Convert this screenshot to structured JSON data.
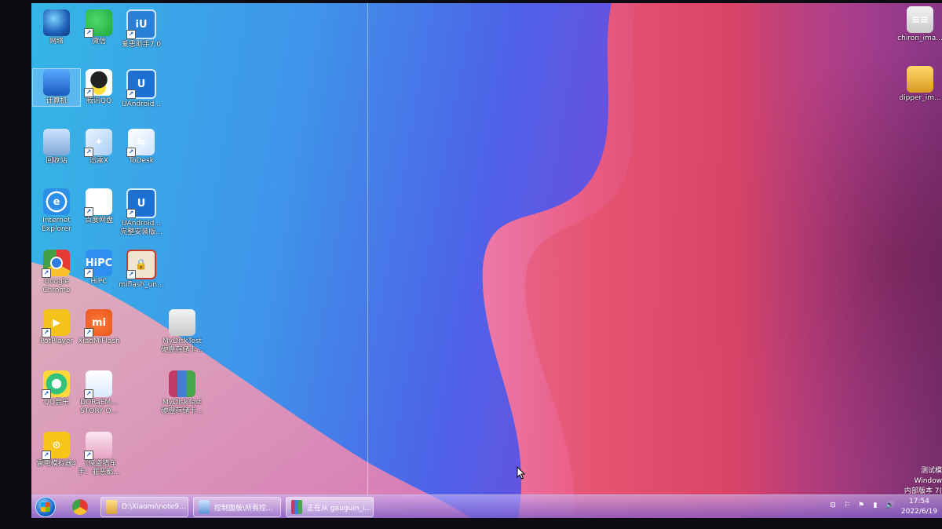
{
  "desktop": {
    "icons": [
      {
        "label": "网络",
        "glyph": "",
        "cls": "g-globe"
      },
      {
        "label": "微信",
        "glyph": "",
        "cls": "g-wechat"
      },
      {
        "label": "爱思助手7.0",
        "glyph": "iU",
        "cls": "g-iu"
      },
      {
        "label": "计算机",
        "glyph": "",
        "cls": "g-pc"
      },
      {
        "label": "腾讯QQ",
        "glyph": "",
        "cls": "g-qq"
      },
      {
        "label": "UAndroid...",
        "glyph": "U",
        "cls": "g-uand"
      },
      {
        "label": "回收站",
        "glyph": "",
        "cls": "g-bin"
      },
      {
        "label": "迅雷X",
        "glyph": "✦",
        "cls": "g-xunlei"
      },
      {
        "label": "ToDesk",
        "glyph": "⇆",
        "cls": "g-todesk"
      },
      {
        "label": "Internet\nExplorer",
        "glyph": "e",
        "cls": "g-ie"
      },
      {
        "label": "百度网盘",
        "glyph": "∞",
        "cls": "g-baidu"
      },
      {
        "label": "UAndroid...\n完整安装版...",
        "glyph": "U",
        "cls": "g-uand"
      },
      {
        "label": "Google\nChrome",
        "glyph": "",
        "cls": "g-chrome"
      },
      {
        "label": "HiPC",
        "glyph": "HiPC",
        "cls": "g-hipc"
      },
      {
        "label": "miflash_un...",
        "glyph": "🔒",
        "cls": "g-miflash"
      },
      {
        "label": "PotPlayer",
        "glyph": "▶",
        "cls": "g-pot"
      },
      {
        "label": "XiaoMiFlash",
        "glyph": "mi",
        "cls": "g-mi"
      },
      {
        "label": "MyDiskTest\n硬盘存储卡...",
        "glyph": "",
        "cls": "g-folder"
      },
      {
        "label": "QQ音乐",
        "glyph": "",
        "cls": "g-qqmusic"
      },
      {
        "label": "DORaEM...\nSTORY O...",
        "glyph": "",
        "cls": "g-dora"
      },
      {
        "label": "MyDiskTest\n硬盘存储卡...",
        "glyph": "",
        "cls": "g-rar"
      },
      {
        "label": "雷电模拟器4",
        "glyph": "⊙",
        "cls": "g-leidian"
      },
      {
        "label": "《侠盗猎车\n手：罪恶都...",
        "glyph": "",
        "cls": "g-anime"
      },
      {
        "label": "chiron_ima...",
        "glyph": "≡≡",
        "cls": "g-chiron"
      },
      {
        "label": "dipper_im...",
        "glyph": "",
        "cls": "g-dipper"
      }
    ],
    "selected_icon": "计算机"
  },
  "watermark": {
    "line1": "测试模",
    "line2": "Window",
    "line3": "内部版本 7("
  },
  "taskbar": {
    "pinned": [
      {
        "name": "start-orb"
      },
      {
        "name": "chrome-icon"
      }
    ],
    "tasks": [
      {
        "label": "D:\\Xiaomi\\note9...",
        "active": false
      },
      {
        "label": "控制面板\\所有控...",
        "active": false
      },
      {
        "label": "正在从 gauguin_i...",
        "active": true
      }
    ],
    "tray": [
      "⊟",
      "⚐",
      "⚑",
      "▮",
      "🔊"
    ],
    "clock": {
      "time": "17:54",
      "date": "2022/6/19"
    }
  },
  "colors": {
    "wallpaper_left": "#35b6e6",
    "wallpaper_mid": "#4d63e8",
    "wallpaper_right": "#7a3ed0",
    "wave_pink": "#f07aa8",
    "wave_red": "#e8404e"
  }
}
